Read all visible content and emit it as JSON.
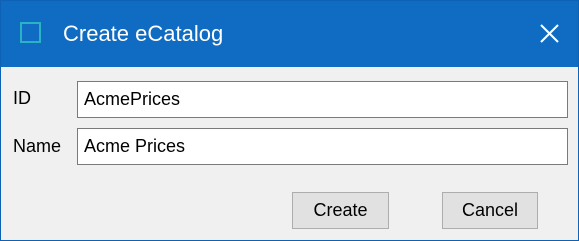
{
  "window": {
    "title": "Create eCatalog",
    "icon": "app-window-icon",
    "close_icon": "close-icon"
  },
  "form": {
    "id_label": "ID",
    "id_value": "AcmePrices",
    "name_label": "Name",
    "name_value": "Acme Prices"
  },
  "buttons": {
    "create_label": "Create",
    "cancel_label": "Cancel"
  },
  "colors": {
    "titlebar": "#0f6cc2",
    "icon_border": "#2ab3c4",
    "dialog_bg": "#f0f0f0",
    "button_bg": "#e1e1e1"
  }
}
